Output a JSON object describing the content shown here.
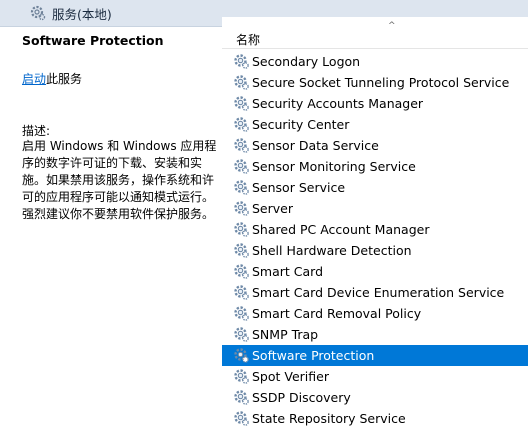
{
  "header": {
    "title": "服务(本地)",
    "icon": "gear-icon"
  },
  "detail": {
    "service_name": "Software Protection",
    "start_link": "启动",
    "start_suffix": "此服务",
    "description_label": "描述:",
    "description": "启用 Windows 和 Windows 应用程序的数字许可证的下载、安装和实施。如果禁用该服务，操作系统和许可的应用程序可能以通知模式运行。强烈建议你不要禁用软件保护服务。"
  },
  "list": {
    "column_name": "名称",
    "sort_indicator": "^",
    "selected_color": "#0078d7",
    "items": [
      {
        "label": "Secondary Logon",
        "selected": false
      },
      {
        "label": "Secure Socket Tunneling Protocol Service",
        "selected": false
      },
      {
        "label": "Security Accounts Manager",
        "selected": false
      },
      {
        "label": "Security Center",
        "selected": false
      },
      {
        "label": "Sensor Data Service",
        "selected": false
      },
      {
        "label": "Sensor Monitoring Service",
        "selected": false
      },
      {
        "label": "Sensor Service",
        "selected": false
      },
      {
        "label": "Server",
        "selected": false
      },
      {
        "label": "Shared PC Account Manager",
        "selected": false
      },
      {
        "label": "Shell Hardware Detection",
        "selected": false
      },
      {
        "label": "Smart Card",
        "selected": false
      },
      {
        "label": "Smart Card Device Enumeration Service",
        "selected": false
      },
      {
        "label": "Smart Card Removal Policy",
        "selected": false
      },
      {
        "label": "SNMP Trap",
        "selected": false
      },
      {
        "label": "Software Protection",
        "selected": true
      },
      {
        "label": "Spot Verifier",
        "selected": false
      },
      {
        "label": "SSDP Discovery",
        "selected": false
      },
      {
        "label": "State Repository Service",
        "selected": false
      }
    ]
  }
}
